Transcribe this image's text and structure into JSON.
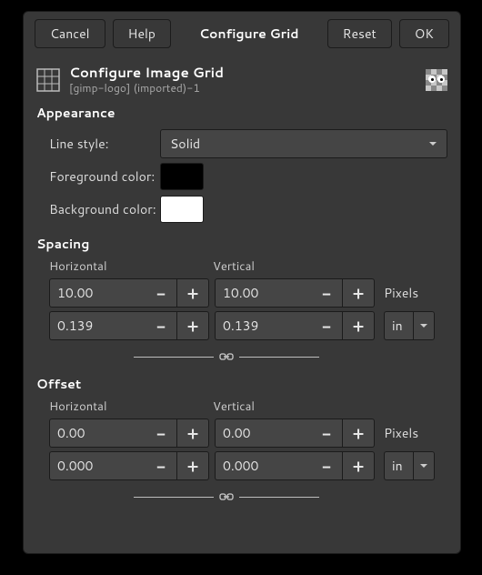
{
  "titlebar": {
    "cancel": "Cancel",
    "help": "Help",
    "title": "Configure Grid",
    "reset": "Reset",
    "ok": "OK"
  },
  "header": {
    "title": "Configure Image Grid",
    "subtitle": "[gimp-logo] (imported)-1"
  },
  "appearance": {
    "section": "Appearance",
    "line_style_label": "Line style:",
    "line_style_value": "Solid",
    "fg_label": "Foreground color:",
    "fg_color": "#000000",
    "bg_label": "Background color:",
    "bg_color": "#ffffff"
  },
  "spacing": {
    "section": "Spacing",
    "horizontal_label": "Horizontal",
    "vertical_label": "Vertical",
    "h_px": "10.00",
    "v_px": "10.00",
    "px_unit": "Pixels",
    "h_unit": "0.139",
    "v_unit": "0.139",
    "unit": "in"
  },
  "offset": {
    "section": "Offset",
    "horizontal_label": "Horizontal",
    "vertical_label": "Vertical",
    "h_px": "0.00",
    "v_px": "0.00",
    "px_unit": "Pixels",
    "h_unit": "0.000",
    "v_unit": "0.000",
    "unit": "in"
  }
}
